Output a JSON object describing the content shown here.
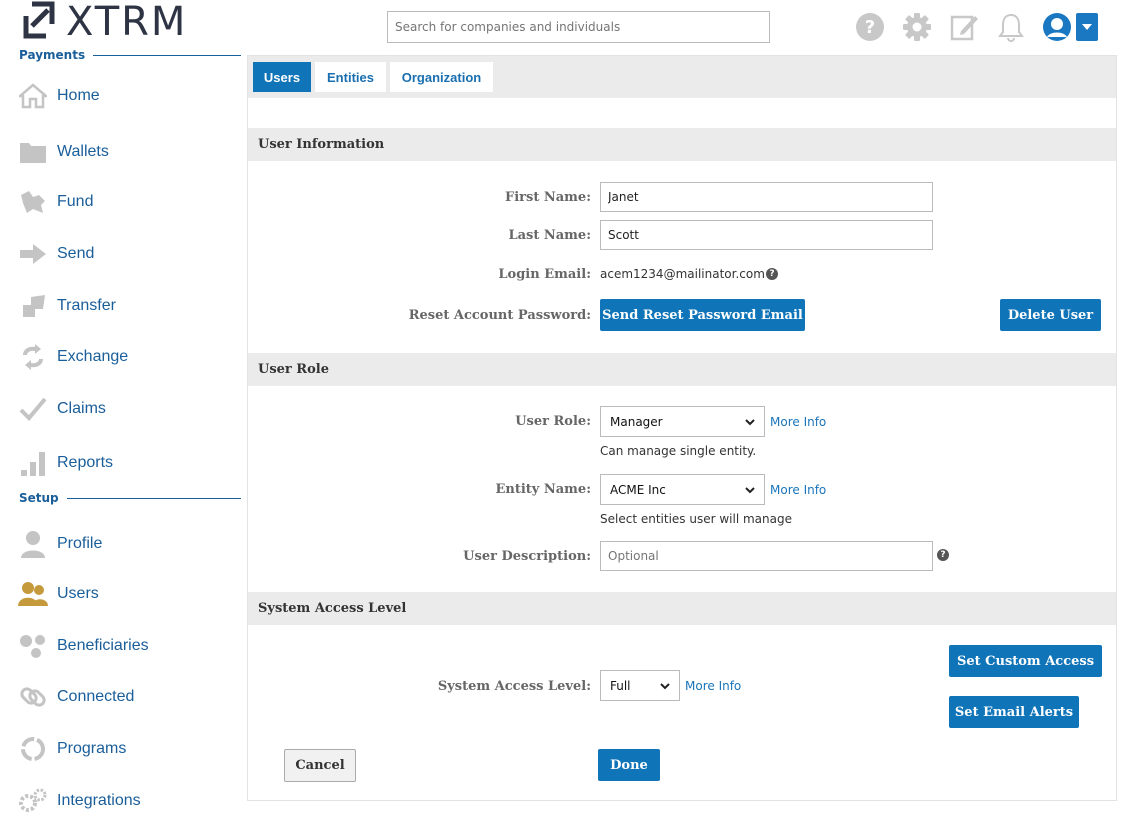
{
  "header": {
    "logo_text": "XTRM",
    "search_placeholder": "Search for companies and individuals"
  },
  "sidebar": {
    "payments_title": "Payments",
    "setup_title": "Setup",
    "payments_items": [
      {
        "label": "Home",
        "icon": "home-icon"
      },
      {
        "label": "Wallets",
        "icon": "folder-icon"
      },
      {
        "label": "Fund",
        "icon": "fund-icon"
      },
      {
        "label": "Send",
        "icon": "send-arrow-icon"
      },
      {
        "label": "Transfer",
        "icon": "transfer-icon"
      },
      {
        "label": "Exchange",
        "icon": "exchange-icon"
      },
      {
        "label": "Claims",
        "icon": "checkmark-icon"
      },
      {
        "label": "Reports",
        "icon": "bar-chart-icon"
      }
    ],
    "setup_items": [
      {
        "label": "Profile",
        "icon": "person-icon"
      },
      {
        "label": "Users",
        "icon": "users-icon"
      },
      {
        "label": "Beneficiaries",
        "icon": "beneficiaries-icon"
      },
      {
        "label": "Connected",
        "icon": "link-icon"
      },
      {
        "label": "Programs",
        "icon": "cycle-icon"
      },
      {
        "label": "Integrations",
        "icon": "gears-icon"
      }
    ],
    "active_item": "Users",
    "colors": {
      "label": "#1a5e9a",
      "icon": "#c4c4c4",
      "active_icon": "#c49a3c"
    }
  },
  "tabs": [
    {
      "label": "Users",
      "active": true
    },
    {
      "label": "Entities",
      "active": false
    },
    {
      "label": "Organization",
      "active": false
    }
  ],
  "user_info": {
    "section_title": "User Information",
    "first_name_label": "First Name:",
    "first_name_value": "Janet",
    "last_name_label": "Last Name:",
    "last_name_value": "Scott",
    "login_email_label": "Login Email:",
    "login_email_value": "acem1234@mailinator.com",
    "reset_label": "Reset Account Password:",
    "reset_button": "Send Reset Password Email",
    "delete_button": "Delete User"
  },
  "user_role": {
    "section_title": "User Role",
    "role_label": "User Role:",
    "role_value": "Manager",
    "role_hint": "Can manage single entity.",
    "entity_label": "Entity Name:",
    "entity_value": "ACME Inc",
    "entity_hint": "Select entities user will manage",
    "description_label": "User Description:",
    "description_placeholder": "Optional",
    "more_info": "More Info"
  },
  "access": {
    "section_title": "System Access Level",
    "level_label": "System Access Level:",
    "level_value": "Full",
    "more_info": "More Info",
    "custom_access_button": "Set Custom Access",
    "email_alerts_button": "Set Email Alerts"
  },
  "footer": {
    "cancel_button": "Cancel",
    "done_button": "Done"
  },
  "colors": {
    "accent": "#0f74b8",
    "link": "#1a75bb",
    "section_bg": "#ebebeb"
  }
}
